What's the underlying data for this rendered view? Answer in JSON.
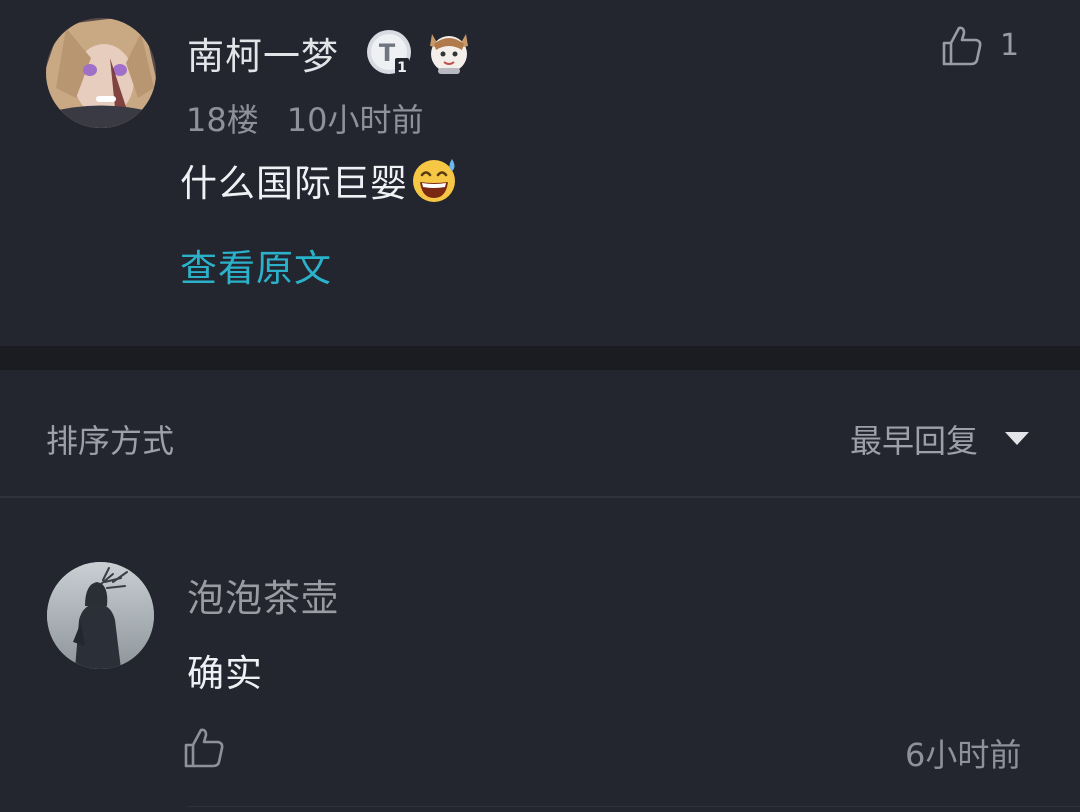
{
  "top_comment": {
    "username": "南柯一梦",
    "level_badge": "T",
    "floor": "18楼",
    "time": "10小时前",
    "content": "什么国际巨婴",
    "emoji": "sweat-smile-emoji",
    "like_count": "1",
    "view_original": "查看原文"
  },
  "sort": {
    "label": "排序方式",
    "value": "最早回复"
  },
  "reply": {
    "username": "泡泡茶壶",
    "content": "确实",
    "time": "6小时前"
  }
}
